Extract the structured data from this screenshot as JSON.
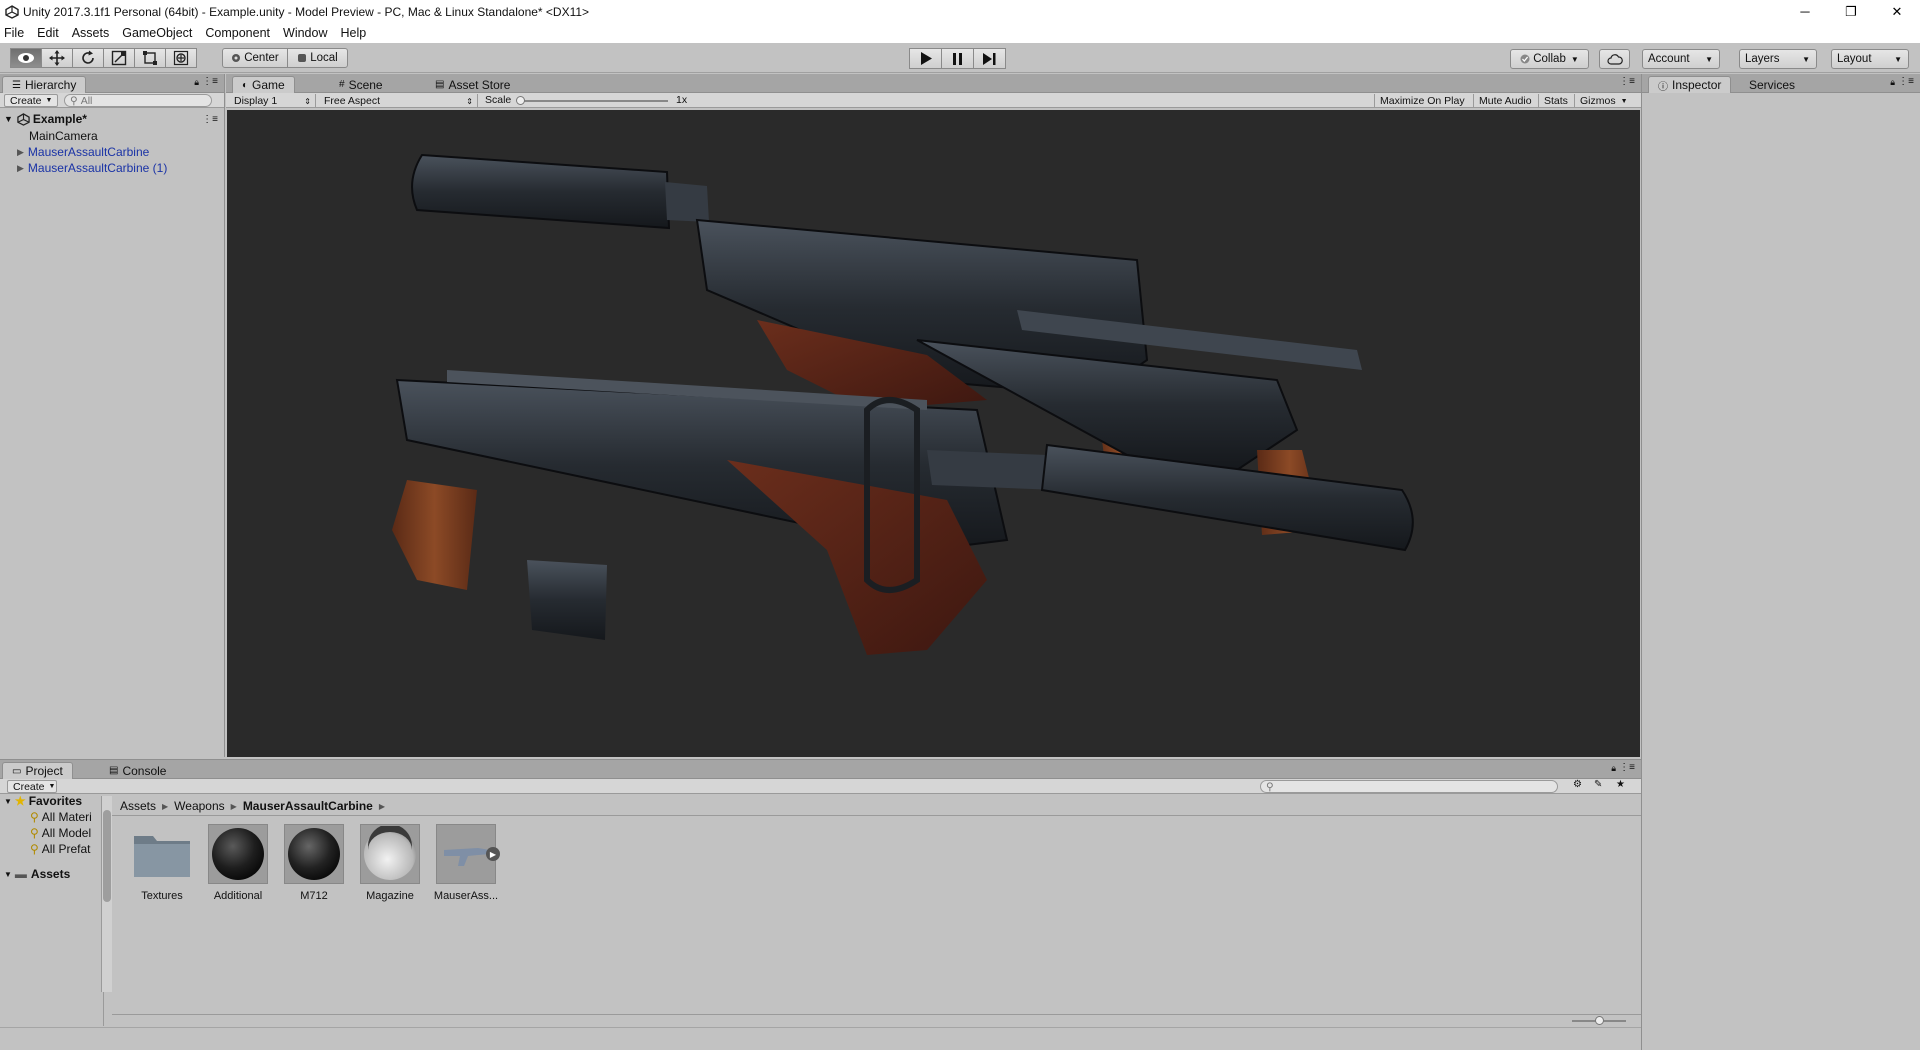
{
  "window": {
    "title": "Unity 2017.3.1f1 Personal (64bit) - Example.unity - Model Preview - PC, Mac & Linux Standalone* <DX11>",
    "minimize": "─",
    "restore": "❐",
    "close": "✕"
  },
  "menu": [
    "File",
    "Edit",
    "Assets",
    "GameObject",
    "Component",
    "Window",
    "Help"
  ],
  "toolbar": {
    "pivot_center": "Center",
    "pivot_local": "Local",
    "collab": "Collab",
    "account": "Account",
    "layers": "Layers",
    "layout": "Layout"
  },
  "hierarchy": {
    "tab": "Hierarchy",
    "create": "Create",
    "search_placeholder": "All",
    "scene": "Example*",
    "items": [
      "MainCamera",
      "MauserAssaultCarbine",
      "MauserAssaultCarbine (1)"
    ]
  },
  "game": {
    "tabs": [
      "Game",
      "Scene",
      "Asset Store"
    ],
    "display": "Display 1",
    "aspect": "Free Aspect",
    "scale_label": "Scale",
    "scale_value": "1x",
    "maximize": "Maximize On Play",
    "mute": "Mute Audio",
    "stats": "Stats",
    "gizmos": "Gizmos"
  },
  "inspector": {
    "tabs": [
      "Inspector",
      "Services"
    ]
  },
  "project": {
    "tabs": [
      "Project",
      "Console"
    ],
    "create": "Create",
    "favorites_label": "Favorites",
    "favorites": [
      "All Materi",
      "All Model",
      "All Prefat"
    ],
    "assets_root": "Assets",
    "breadcrumb": [
      "Assets",
      "Weapons",
      "MauserAssaultCarbine"
    ],
    "assets": [
      {
        "name": "Textures",
        "kind": "folder"
      },
      {
        "name": "Additional",
        "kind": "material"
      },
      {
        "name": "M712",
        "kind": "material"
      },
      {
        "name": "Magazine",
        "kind": "material-light"
      },
      {
        "name": "MauserAss...",
        "kind": "model"
      }
    ]
  },
  "colors": {
    "viewport_bg": "#2a2a2a",
    "editor_bg": "#c2c2c2",
    "link_blue": "#1a33a6"
  }
}
